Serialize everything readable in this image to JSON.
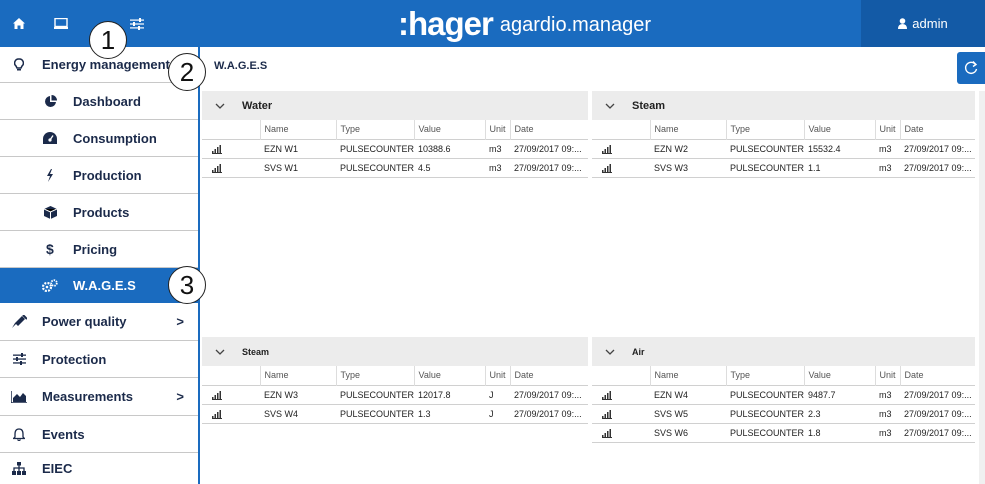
{
  "header": {
    "brand": ":hager",
    "product": "agardio.manager",
    "user": "admin",
    "home_icon": "home-icon",
    "screen_icon": "monitor-icon",
    "sliders_icon": "sliders-icon"
  },
  "callouts": [
    "1",
    "2",
    "3"
  ],
  "sidebar": {
    "items": [
      {
        "label": "Energy management",
        "icon": "lightbulb-icon",
        "level": "top"
      },
      {
        "label": "Dashboard",
        "icon": "pie-chart-icon",
        "level": "sub"
      },
      {
        "label": "Consumption",
        "icon": "gauge-icon",
        "level": "sub"
      },
      {
        "label": "Production",
        "icon": "bolt-icon",
        "level": "sub"
      },
      {
        "label": "Products",
        "icon": "box-icon",
        "level": "sub"
      },
      {
        "label": "Pricing",
        "icon": "dollar-icon",
        "level": "sub"
      },
      {
        "label": "W.A.G.E.S",
        "icon": "gears-icon",
        "level": "sub",
        "active": true
      },
      {
        "label": "Power quality",
        "icon": "plug-icon",
        "level": "top",
        "chevron": ">"
      },
      {
        "label": "Protection",
        "icon": "sliders-icon",
        "level": "top"
      },
      {
        "label": "Measurements",
        "icon": "area-chart-icon",
        "level": "top",
        "chevron": ">"
      },
      {
        "label": "Events",
        "icon": "bell-icon",
        "level": "top"
      },
      {
        "label": "EIEC",
        "icon": "sitemap-icon",
        "level": "top"
      }
    ]
  },
  "breadcrumb": "W.A.G.E.S",
  "columns": {
    "name": "Name",
    "type": "Type",
    "value": "Value",
    "unit": "Unit",
    "date": "Date"
  },
  "panels": [
    {
      "title": "Water",
      "rows": [
        {
          "name": "EZN W1",
          "type": "PULSECOUNTER",
          "value": "10388.6",
          "unit": "m3",
          "date": "27/09/2017 09:..."
        },
        {
          "name": "SVS W1",
          "type": "PULSECOUNTER",
          "value": "4.5",
          "unit": "m3",
          "date": "27/09/2017 09:..."
        }
      ]
    },
    {
      "title": "Steam",
      "rows": [
        {
          "name": "EZN W2",
          "type": "PULSECOUNTER",
          "value": "15532.4",
          "unit": "m3",
          "date": "27/09/2017 09:..."
        },
        {
          "name": "SVS W3",
          "type": "PULSECOUNTER",
          "value": "1.1",
          "unit": "m3",
          "date": "27/09/2017 09:..."
        }
      ]
    },
    {
      "title": "Steam",
      "rows": [
        {
          "name": "EZN W3",
          "type": "PULSECOUNTER",
          "value": "12017.8",
          "unit": "J",
          "date": "27/09/2017 09:..."
        },
        {
          "name": "SVS W4",
          "type": "PULSECOUNTER",
          "value": "1.3",
          "unit": "J",
          "date": "27/09/2017 09:..."
        }
      ]
    },
    {
      "title": "Air",
      "rows": [
        {
          "name": "EZN W4",
          "type": "PULSECOUNTER",
          "value": "9487.7",
          "unit": "m3",
          "date": "27/09/2017 09:..."
        },
        {
          "name": "SVS W5",
          "type": "PULSECOUNTER",
          "value": "2.3",
          "unit": "m3",
          "date": "27/09/2017 09:..."
        },
        {
          "name": "SVS W6",
          "type": "PULSECOUNTER",
          "value": "1.8",
          "unit": "m3",
          "date": "27/09/2017 09:..."
        }
      ]
    }
  ],
  "colors": {
    "primary": "#1a6bbf",
    "header_user": "#135aa6",
    "panel_head": "#ececec"
  }
}
